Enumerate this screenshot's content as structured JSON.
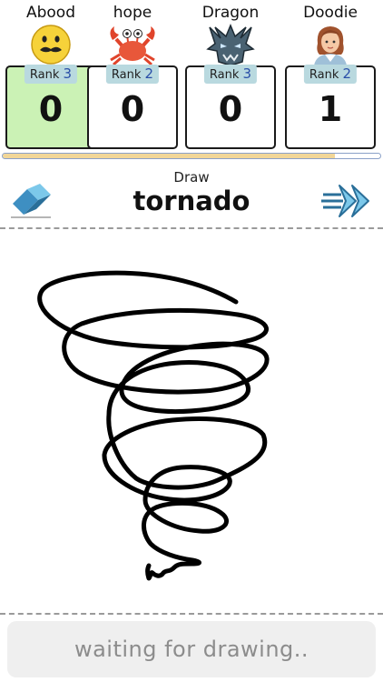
{
  "players": [
    {
      "name": "Abood",
      "rank_label": "Rank",
      "rank": "3",
      "score": "0",
      "avatar": "mustache-face-icon",
      "active": true
    },
    {
      "name": "hope",
      "rank_label": "Rank",
      "rank": "2",
      "score": "0",
      "avatar": "crab-icon",
      "active": false
    },
    {
      "name": "Dragon",
      "rank_label": "Rank",
      "rank": "3",
      "score": "0",
      "avatar": "dragon-icon",
      "active": false
    },
    {
      "name": "Doodie",
      "rank_label": "Rank",
      "rank": "2",
      "score": "1",
      "avatar": "woman-icon",
      "active": false
    }
  ],
  "timer_progress": 0.88,
  "prompt": {
    "label": "Draw",
    "word": "tornado"
  },
  "tools": {
    "eraser_icon": "eraser-icon",
    "next_icon": "fast-forward-arrows-icon"
  },
  "status": {
    "text": "waiting for drawing.."
  },
  "colors": {
    "active_card": "#cbf2b5",
    "rank_badge": "#b9d9df",
    "progress_fill": "#f1d698",
    "progress_border": "#8aa0c8",
    "status_bg": "#efefef"
  }
}
